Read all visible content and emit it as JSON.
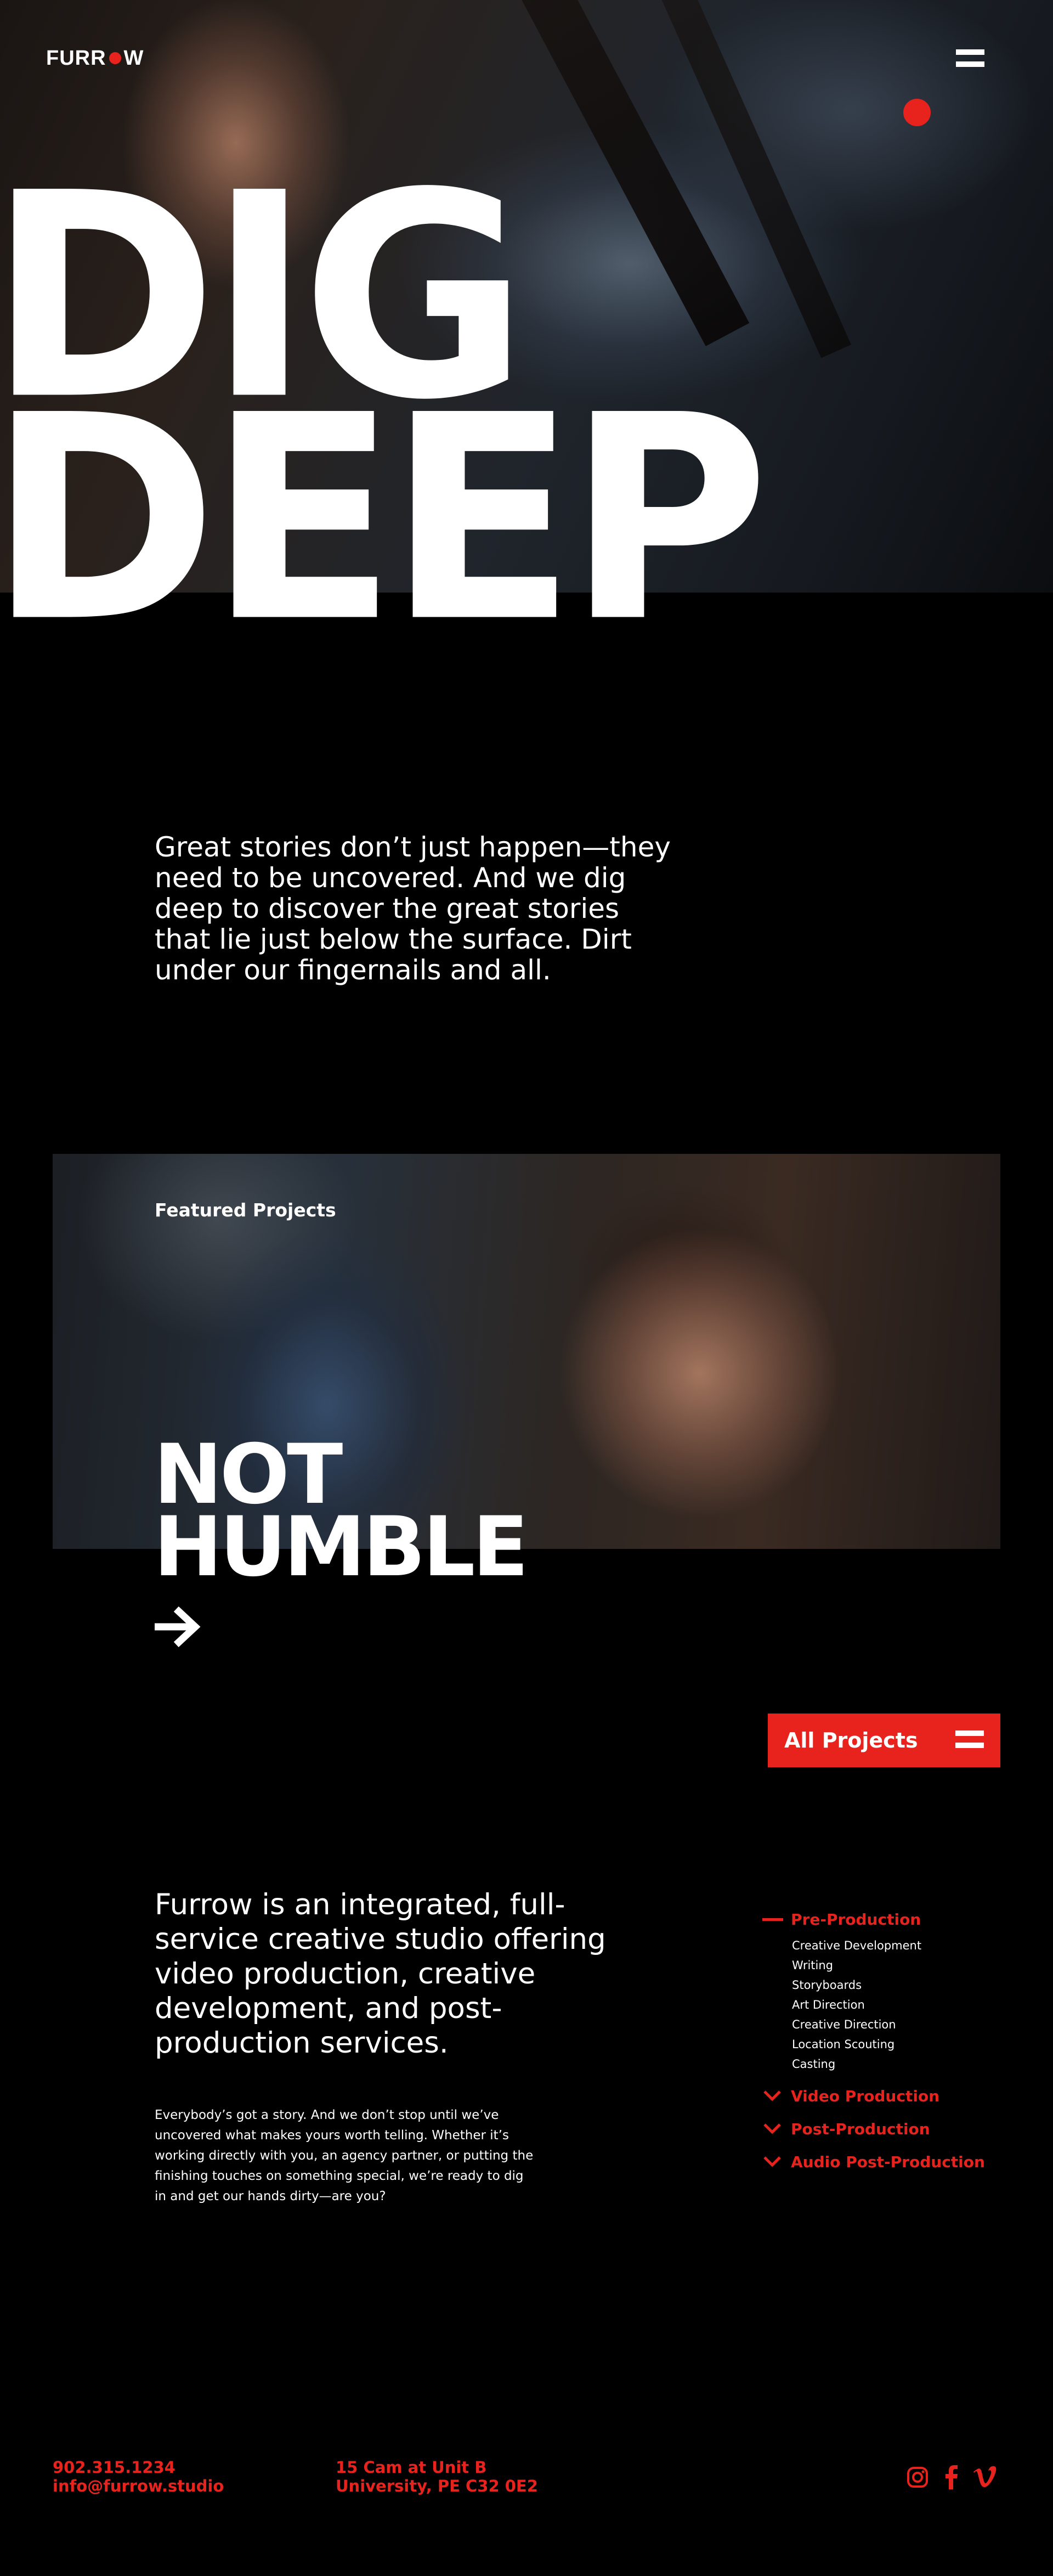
{
  "header": {
    "logo_text_left": "FURR",
    "logo_text_right": "W",
    "menu_icon": "hamburger-icon"
  },
  "hero": {
    "title_line1": "DIG",
    "title_line2": "DEEP"
  },
  "intro": {
    "text": "Great stories don’t just happen—they need to be uncovered. And we dig deep to discover the great stories that lie just below the surface. Dirt under our fingernails and all."
  },
  "featured": {
    "label": "Featured Projects",
    "project_title_line1": "NOT",
    "project_title_line2": "HUMBLE",
    "arrow_icon": "arrow-right-icon"
  },
  "all_projects": {
    "label": "All Projects",
    "icon": "hamburger-icon"
  },
  "about": {
    "lead": "Furrow is an integrated, full-service creative studio offering video production, creative development, and post-production services.",
    "body": "Everybody’s got a story. And we don’t stop until we’ve uncovered what makes yours worth telling. Whether it’s working directly with you, an agency partner, or putting the finishing touches on something special, we’re ready to dig in and get our hands dirty—are you?"
  },
  "services": [
    {
      "label": "Pre-Production",
      "state": "expanded",
      "items": [
        "Creative Development",
        "Writing",
        "Storyboards",
        "Art Direction",
        "Creative Direction",
        "Location Scouting",
        "Casting"
      ]
    },
    {
      "label": "Video Production",
      "state": "collapsed",
      "items": []
    },
    {
      "label": "Post-Production",
      "state": "collapsed",
      "items": []
    },
    {
      "label": "Audio Post-Production",
      "state": "collapsed",
      "items": []
    }
  ],
  "footer": {
    "phone": "902.315.1234",
    "email": "info@furrow.studio",
    "address_line1": "15 Cam at Unit B",
    "address_line2": "University, PE C32 0E2",
    "social": [
      "instagram-icon",
      "facebook-icon",
      "vimeo-icon"
    ]
  },
  "colors": {
    "accent": "#e8231d",
    "background": "#000000",
    "text": "#ffffff"
  }
}
